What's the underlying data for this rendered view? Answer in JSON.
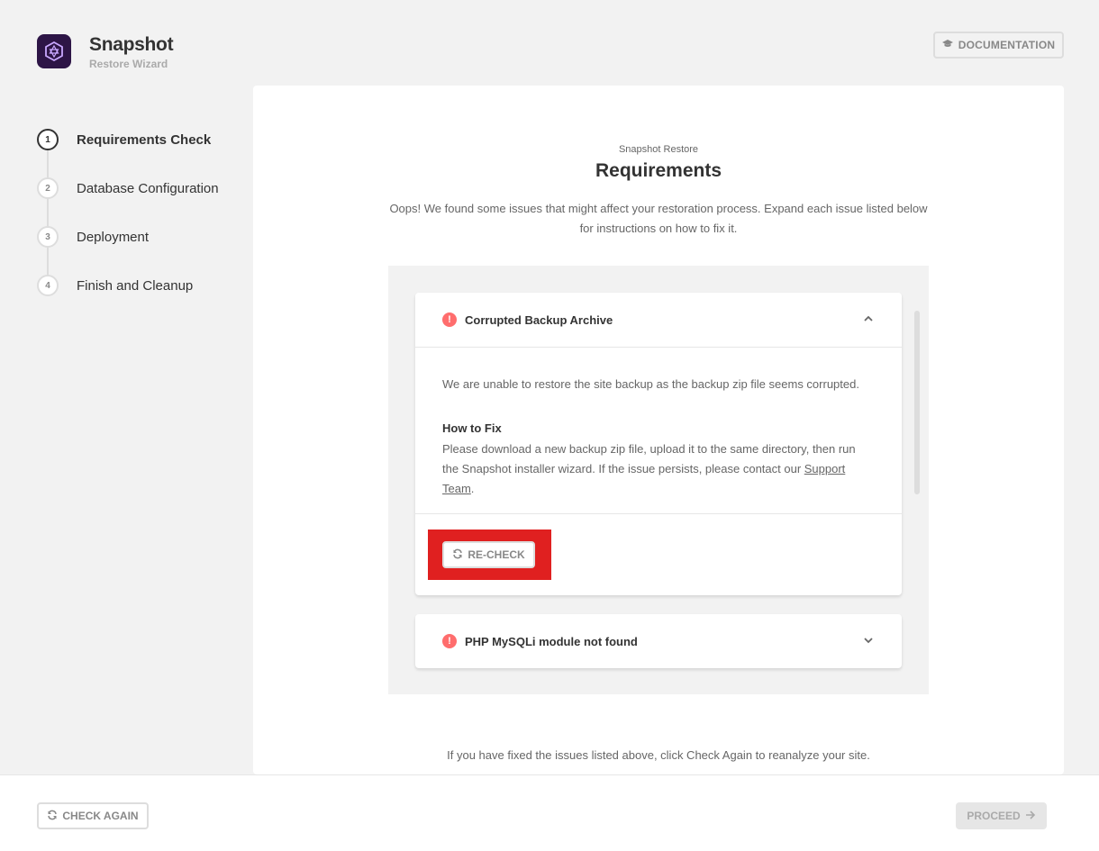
{
  "app": {
    "title": "Snapshot",
    "subtitle": "Restore Wizard",
    "logo_icon": "snapshot-logo-icon",
    "brand_color": "#2d1546"
  },
  "header": {
    "documentation_label": "DOCUMENTATION",
    "documentation_icon": "graduation-cap-icon"
  },
  "steps": [
    {
      "number": "1",
      "label": "Requirements Check",
      "active": true
    },
    {
      "number": "2",
      "label": "Database Configuration",
      "active": false
    },
    {
      "number": "3",
      "label": "Deployment",
      "active": false
    },
    {
      "number": "4",
      "label": "Finish and Cleanup",
      "active": false
    }
  ],
  "main": {
    "kicker": "Snapshot Restore",
    "title": "Requirements",
    "intro": "Oops! We found some issues that might affect your restoration process. Expand each issue listed below for instructions on how to fix it.",
    "issues": [
      {
        "title": "Corrupted Backup Archive",
        "expanded": true,
        "description": "We are unable to restore the site backup as the backup zip file seems corrupted.",
        "fix_title": "How to Fix",
        "fix_text_before": "Please download a new backup zip file, upload it to the same directory, then run the Snapshot installer wizard. If the issue persists, please contact our ",
        "fix_link": "Support Team",
        "fix_text_after": ".",
        "recheck_label": "RE-CHECK"
      },
      {
        "title": "PHP MySQLi module not found",
        "expanded": false
      }
    ],
    "footer_note": "If you have fixed the issues listed above, click Check Again to reanalyze your site."
  },
  "bottom": {
    "check_again_label": "CHECK AGAIN",
    "proceed_label": "PROCEED"
  },
  "colors": {
    "warning": "#ff6d6d",
    "highlight": "#e02020"
  }
}
